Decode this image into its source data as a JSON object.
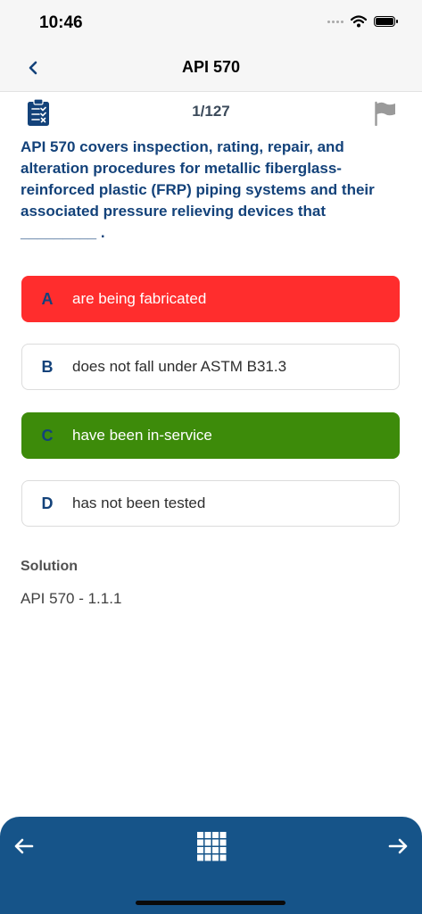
{
  "status_bar": {
    "time": "10:46"
  },
  "header": {
    "title": "API 570"
  },
  "question": {
    "counter": "1/127",
    "text": "API 570 covers inspection, rating, repair, and alteration procedures for metallic fiberglass-reinforced plastic (FRP) piping systems and their associated pressure relieving devices that _________ ."
  },
  "options": [
    {
      "letter": "A",
      "text": "are being fabricated",
      "state": "wrong"
    },
    {
      "letter": "B",
      "text": "does not fall under ASTM B31.3",
      "state": "neutral"
    },
    {
      "letter": "C",
      "text": "have been in-service",
      "state": "correct"
    },
    {
      "letter": "D",
      "text": "has not been tested",
      "state": "neutral"
    }
  ],
  "solution": {
    "heading": "Solution",
    "text": "API 570 - 1.1.1"
  },
  "colors": {
    "primary": "#13427a",
    "bottom_bar": "#165489",
    "wrong": "#ff2d2d",
    "correct": "#3d8b0a"
  },
  "icons": {
    "back": "chevron-left-icon",
    "clipboard": "clipboard-icon",
    "flag": "flag-icon",
    "prev": "arrow-left-icon",
    "grid": "grid-icon",
    "next": "arrow-right-icon"
  }
}
